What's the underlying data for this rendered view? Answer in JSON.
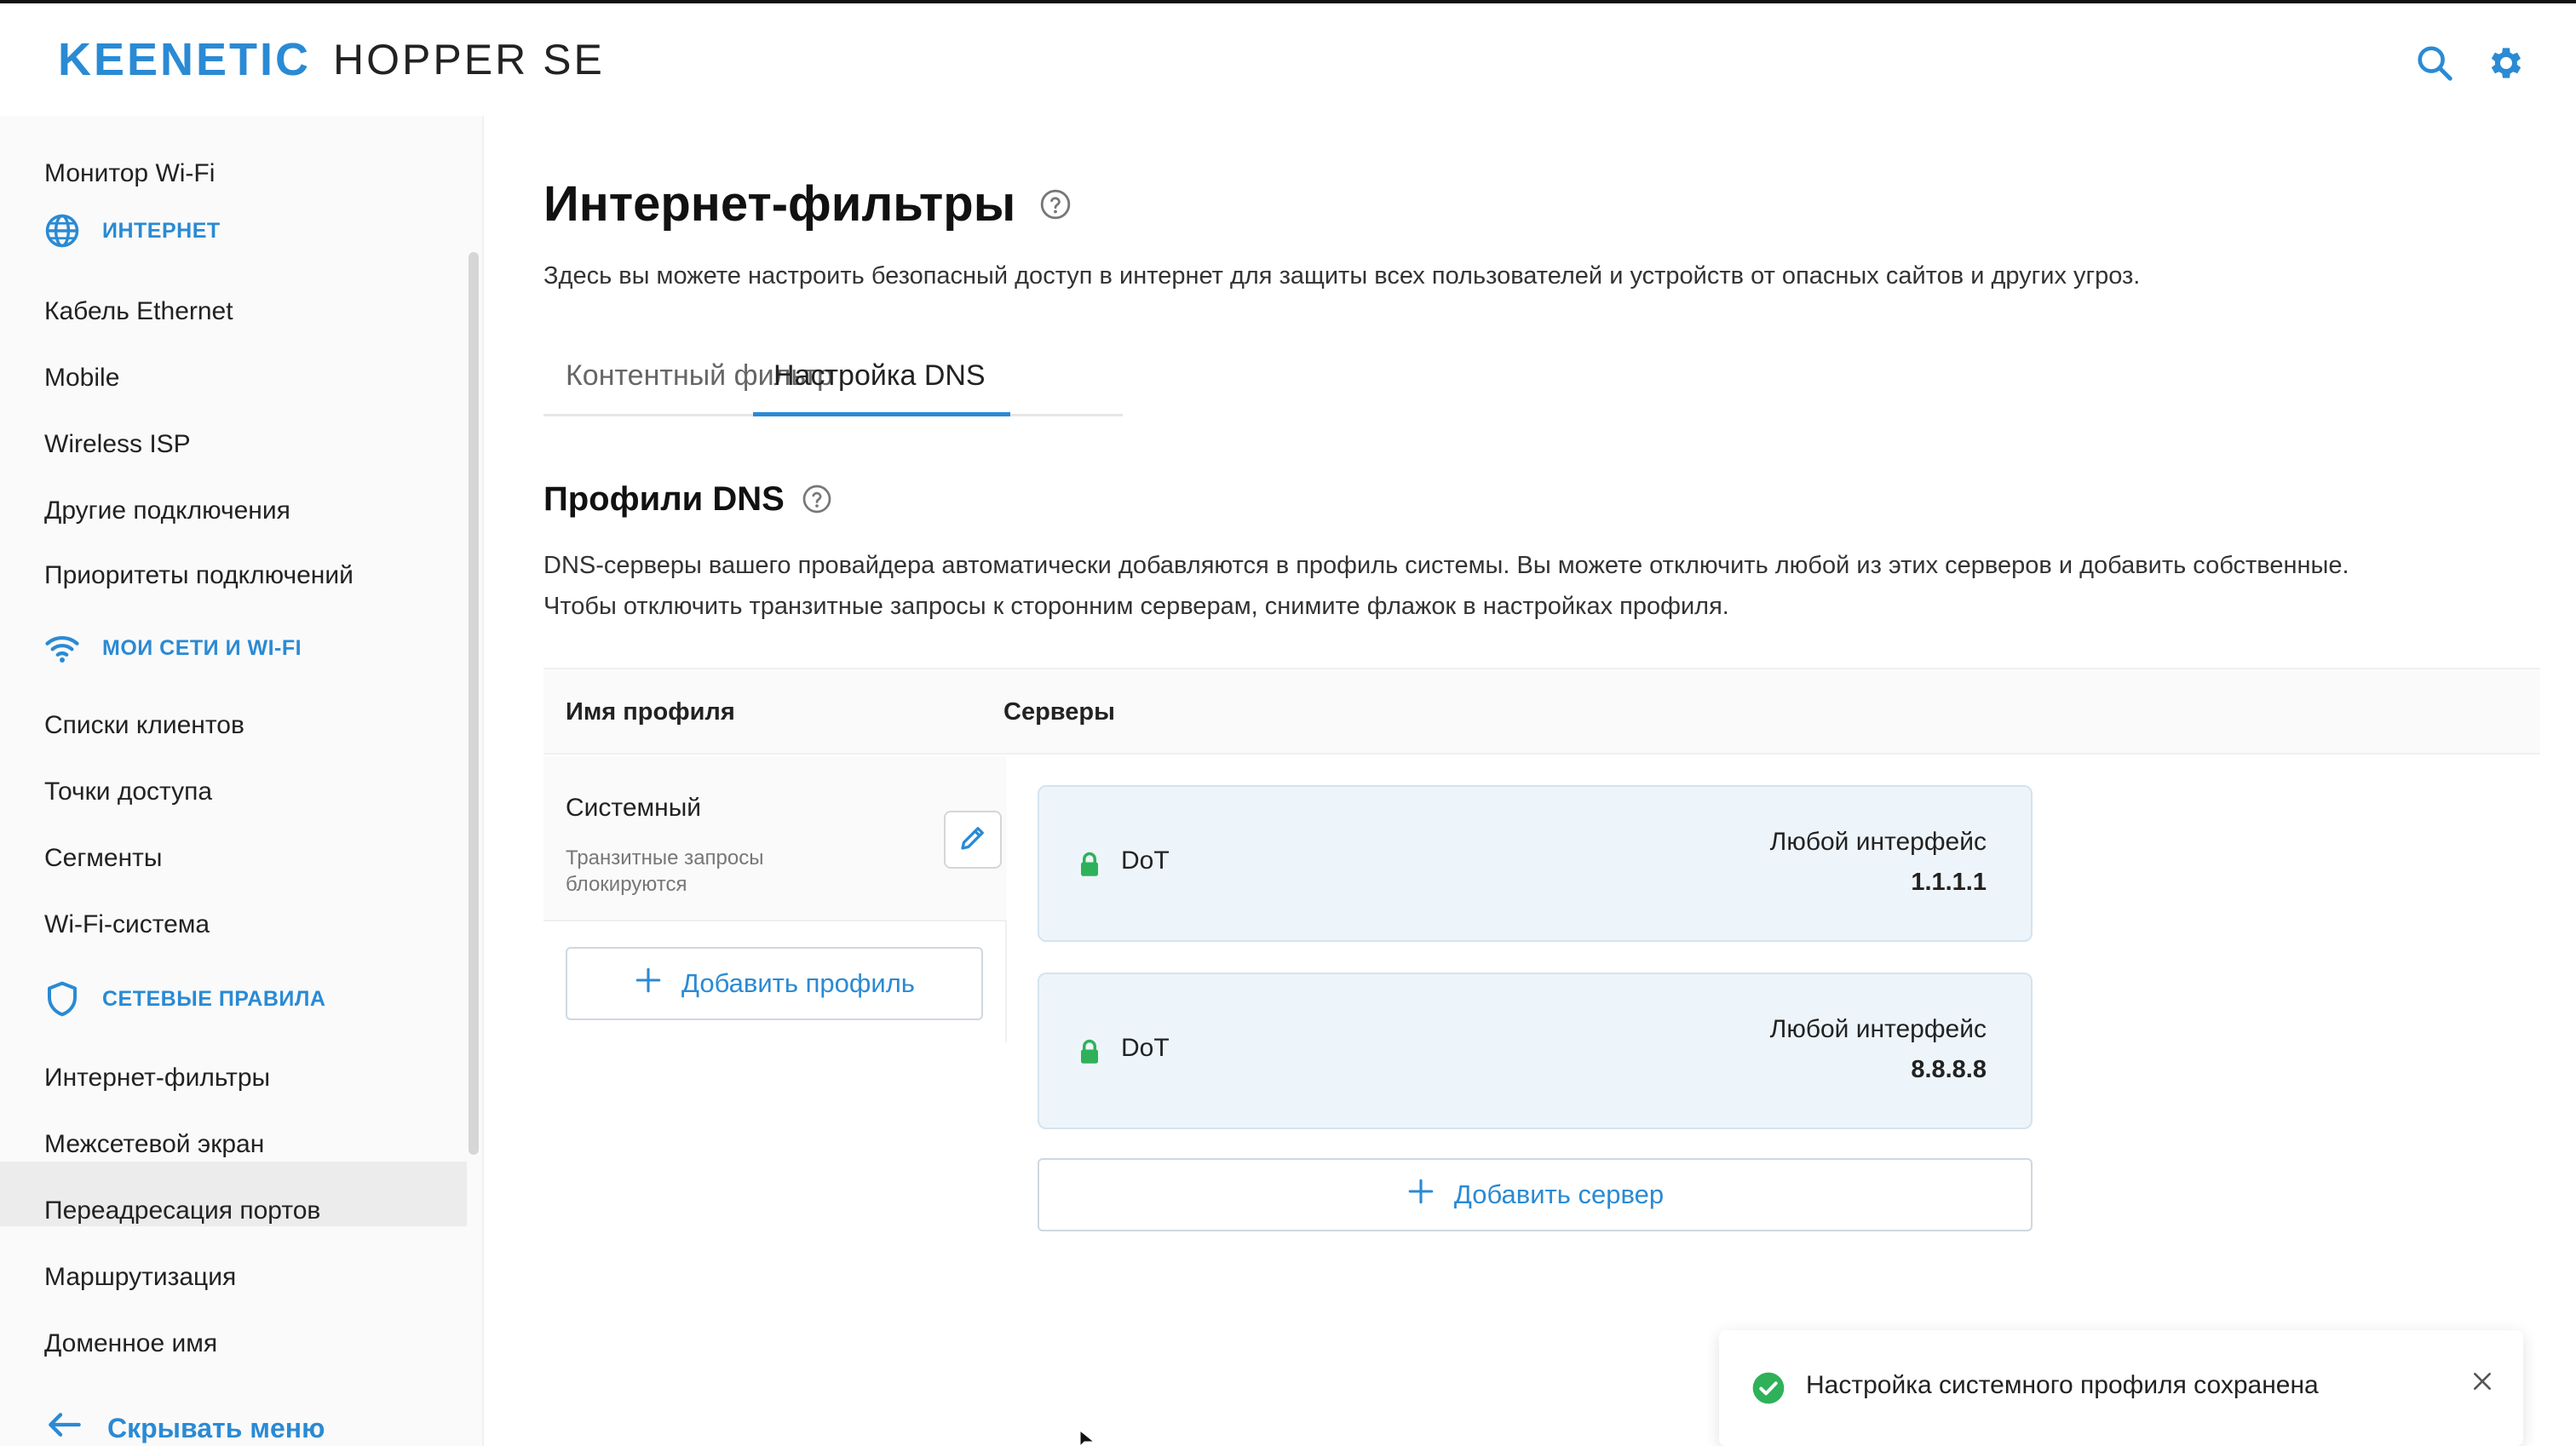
{
  "header": {
    "brand": "KEENETIC",
    "model": "HOPPER SE",
    "icons": [
      "search-icon",
      "gear-icon"
    ],
    "accent_color": "#2a8ad4"
  },
  "sidebar": {
    "items": [
      {
        "label": "Монитор Wi-Fi"
      },
      {
        "label": "ИНТЕРНЕТ",
        "section": true,
        "icon": "globe-icon"
      },
      {
        "label": "Кабель Ethernet"
      },
      {
        "label": "Mobile"
      },
      {
        "label": "Wireless ISP"
      },
      {
        "label": "Другие подключения"
      },
      {
        "label": "Приоритеты подключений"
      },
      {
        "label": "МОИ СЕТИ И WI-FI",
        "section": true,
        "icon": "wifi-icon"
      },
      {
        "label": "Списки клиентов"
      },
      {
        "label": "Точки доступа"
      },
      {
        "label": "Сегменты"
      },
      {
        "label": "Wi-Fi-система"
      },
      {
        "label": "СЕТЕВЫЕ ПРАВИЛА",
        "section": true,
        "icon": "shield-icon"
      },
      {
        "label": "Интернет-фильтры",
        "active": true
      },
      {
        "label": "Межсетевой экран"
      },
      {
        "label": "Переадресация портов"
      },
      {
        "label": "Маршрутизация"
      },
      {
        "label": "Доменное имя"
      }
    ],
    "hide_menu_label": "Скрывать меню"
  },
  "main": {
    "title": "Интернет-фильтры",
    "description": "Здесь вы можете настроить безопасный доступ в интернет для защиты всех пользователей и устройств от опасных сайтов и других угроз.",
    "tabs": [
      {
        "label": "Контентный фильтр",
        "active": false
      },
      {
        "label": "Настройка DNS",
        "active": true
      }
    ],
    "dns_section": {
      "title": "Профили DNS",
      "description_line1": "DNS-серверы вашего провайдера автоматически добавляются в профиль системы. Вы можете отключить любой из этих серверов и добавить собственные.",
      "description_line2": "Чтобы отключить транзитные запросы к сторонним серверам, снимите флажок в настройках профиля."
    },
    "table": {
      "col_profile": "Имя профиля",
      "col_servers": "Серверы"
    },
    "profile": {
      "name": "Системный",
      "subtitle": "Транзитные запросы блокируются",
      "add_profile_label": "Добавить профиль"
    },
    "servers": [
      {
        "protocol": "DoT",
        "interface": "Любой интерфейс",
        "ip": "1.1.1.1"
      },
      {
        "protocol": "DoT",
        "interface": "Любой интерфейс",
        "ip": "8.8.8.8"
      }
    ],
    "add_server_label": "Добавить сервер"
  },
  "toast": {
    "message": "Настройка системного профиля сохранена",
    "status_color": "#2fb15a"
  }
}
